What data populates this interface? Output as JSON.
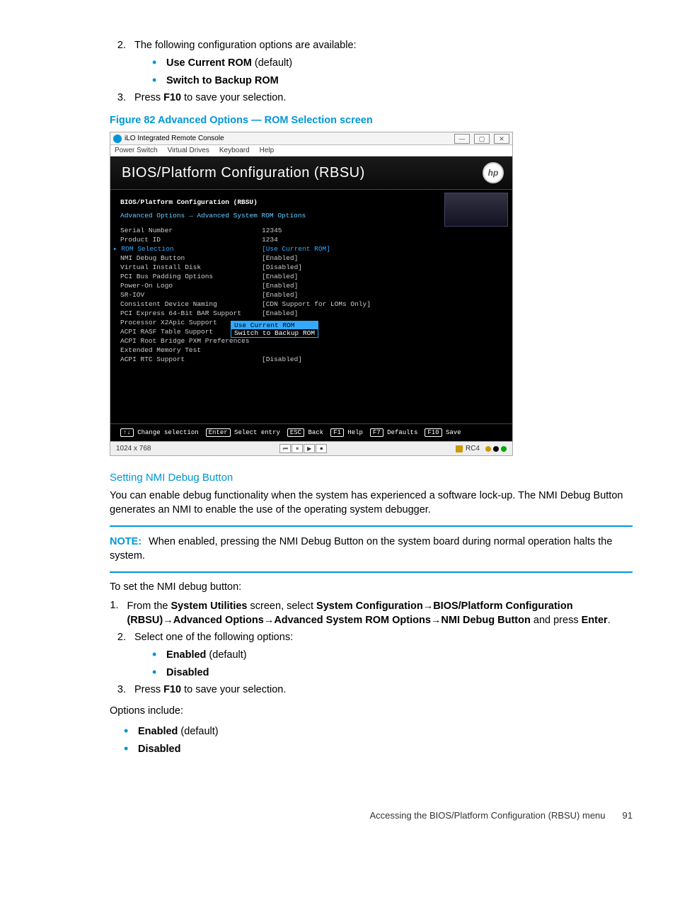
{
  "doc": {
    "steps_a": {
      "num2": "2.",
      "text2": "The following configuration options are available:",
      "opt1_bold": "Use Current ROM",
      "opt1_rest": " (default)",
      "opt2_bold": "Switch to Backup ROM",
      "num3": "3.",
      "text3a": "Press ",
      "text3b": "F10",
      "text3c": " to save your selection."
    },
    "figcap": "Figure 82 Advanced Options — ROM Selection screen",
    "h2": "Setting NMI Debug Button",
    "p1": "You can enable debug functionality when the system has experienced a software lock-up. The NMI Debug Button generates an NMI to enable the use of the operating system debugger.",
    "note_label": "NOTE:",
    "note_text": "When enabled, pressing the NMI Debug Button on the system board during normal operation halts the system.",
    "p2": "To set the NMI debug button:",
    "steps_b": {
      "n1": "1.",
      "t1a": "From the ",
      "t1b": "System Utilities",
      "t1c": " screen, select ",
      "t1d": "System Configuration",
      "t1e": "→",
      "t1f": "BIOS/Platform Configuration (RBSU)",
      "t1g": "→",
      "t1h": "Advanced Options",
      "t1i": "→",
      "t1j": "Advanced System ROM Options",
      "t1k": "→",
      "t1l": "NMI Debug Button",
      "t1m": " and press ",
      "t1n": "Enter",
      "t1o": ".",
      "n2": "2.",
      "t2": "Select one of the following options:",
      "o1b": "Enabled",
      "o1r": " (default)",
      "o2b": "Disabled",
      "n3": "3.",
      "t3a": "Press ",
      "t3b": "F10",
      "t3c": " to save your selection."
    },
    "p3": "Options include:",
    "opts2": {
      "o1b": "Enabled",
      "o1r": " (default)",
      "o2b": "Disabled"
    },
    "footer_text": "Accessing the BIOS/Platform Configuration (RBSU) menu",
    "footer_page": "91"
  },
  "shot": {
    "title": "iLO Integrated Remote Console",
    "winbtns": {
      "min": "—",
      "max": "▢",
      "close": "✕"
    },
    "menus": [
      "Power Switch",
      "Virtual Drives",
      "Keyboard",
      "Help"
    ],
    "bios_title": "BIOS/Platform Configuration (RBSU)",
    "hp": "hp",
    "hdr": "BIOS/Platform Configuration (RBSU)",
    "path": "Advanced Options → Advanced System ROM Options",
    "rows": [
      {
        "l": "Serial Number",
        "r": "12345"
      },
      {
        "l": "Product ID",
        "r": "1234"
      },
      {
        "l": "ROM Selection",
        "r": "[Use Current ROM]",
        "sel": true
      },
      {
        "l": "NMI Debug Button",
        "r": "[Enabled]"
      },
      {
        "l": "Virtual Install Disk",
        "r": "[Disabled]"
      },
      {
        "l": "PCI Bus Padding Options",
        "r": "[Enabled]"
      },
      {
        "l": "Power-On Logo",
        "r": "[Enabled]"
      },
      {
        "l": "SR-IOV",
        "r": "[Enabled]"
      },
      {
        "l": "Consistent Device Naming",
        "r": "[CDN Support for LOMs Only]"
      },
      {
        "l": "PCI Express 64-Bit BAR Support",
        "r": "[Enabled]"
      },
      {
        "l": "Processor X2Apic Support",
        "r": ""
      },
      {
        "l": "ACPI RASF Table Support",
        "r": ""
      },
      {
        "l": "ACPI Root Bridge PXM Preferences",
        "r": ""
      },
      {
        "l": "Extended Memory Test",
        "r": ""
      },
      {
        "l": "ACPI RTC Support",
        "r": "[Disabled]"
      }
    ],
    "popup": {
      "hl": "Use Current ROM",
      "nm": "Switch to Backup ROM"
    },
    "keys": [
      {
        "k": "↑↓",
        "t": "Change selection"
      },
      {
        "k": "Enter",
        "t": "Select entry"
      },
      {
        "k": "ESC",
        "t": "Back"
      },
      {
        "k": "F1",
        "t": "Help"
      },
      {
        "k": "F7",
        "t": "Defaults"
      },
      {
        "k": "F10",
        "t": "Save"
      }
    ],
    "status": {
      "res": "1024 x 768",
      "btns": [
        "⏮",
        "⏸",
        "▶",
        "⏺"
      ],
      "enc": "RC4",
      "dots": [
        "#c90",
        "#000",
        "#0a0"
      ]
    }
  }
}
